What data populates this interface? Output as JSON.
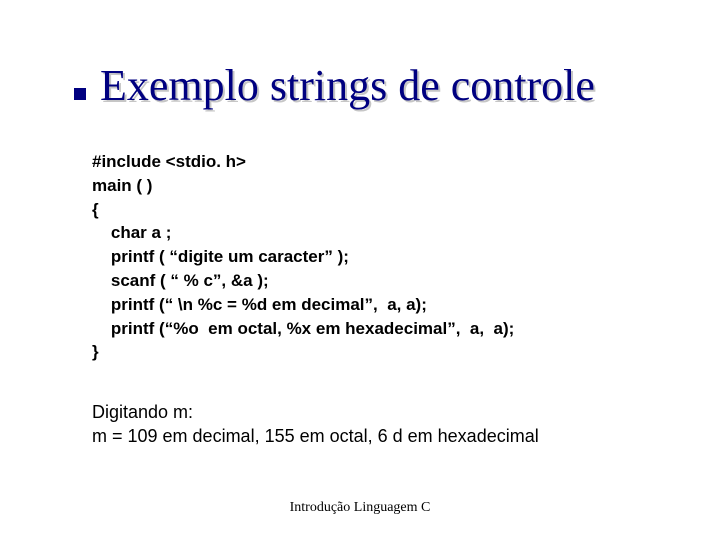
{
  "title": "Exemplo strings de controle",
  "code_lines": [
    "#include <stdio. h>",
    "main ( )",
    "{",
    "    char a ;",
    "    printf ( “digite um caracter” );",
    "    scanf ( “ % c”, &a );",
    "    printf (“ \\n %c = %d em decimal”,  a, a);",
    "    printf (“%o  em octal, %x em hexadecimal”,  a,  a);",
    "}"
  ],
  "result_lines": [
    "Digitando m:",
    " m = 109 em decimal, 155 em octal, 6 d em hexadecimal"
  ],
  "footer": "Introdução Linguagem C"
}
